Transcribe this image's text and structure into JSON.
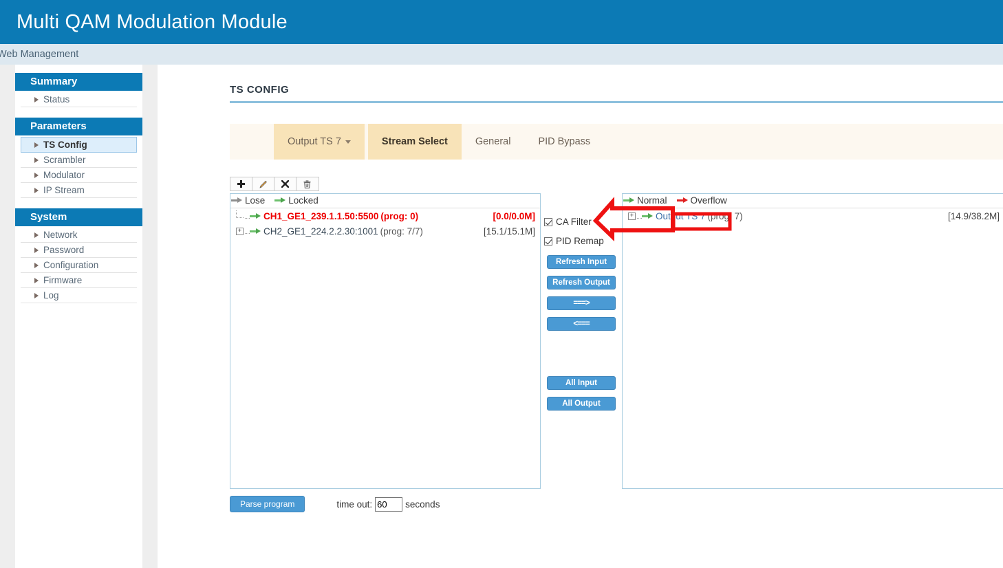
{
  "header": {
    "app_title": "Multi QAM Modulation Module",
    "subheader": "Web Management",
    "brand_color": "#0c7ab5"
  },
  "sidebar": {
    "sections": [
      {
        "title": "Summary",
        "items": [
          {
            "label": "Status",
            "active": false
          }
        ]
      },
      {
        "title": "Parameters",
        "items": [
          {
            "label": "TS Config",
            "active": true
          },
          {
            "label": "Scrambler",
            "active": false
          },
          {
            "label": "Modulator",
            "active": false
          },
          {
            "label": "IP Stream",
            "active": false
          }
        ]
      },
      {
        "title": "System",
        "items": [
          {
            "label": "Network",
            "active": false
          },
          {
            "label": "Password",
            "active": false
          },
          {
            "label": "Configuration",
            "active": false
          },
          {
            "label": "Firmware",
            "active": false
          },
          {
            "label": "Log",
            "active": false
          }
        ]
      }
    ]
  },
  "main": {
    "page_title": "TS CONFIG",
    "tabs": [
      {
        "label": "Output TS 7",
        "type": "dropdown",
        "active": false,
        "tinted": true
      },
      {
        "label": "Stream Select",
        "type": "tab",
        "active": true,
        "tinted": true
      },
      {
        "label": "General",
        "type": "tab",
        "active": false,
        "tinted": false
      },
      {
        "label": "PID Bypass",
        "type": "tab",
        "active": false,
        "tinted": false
      }
    ],
    "toolbar": {
      "add_label": "+",
      "edit_label": "✎",
      "close_label": "✖",
      "delete_label": "Ὕ1"
    },
    "input_panel": {
      "legend": [
        {
          "label": "Lose",
          "arrow": "gray"
        },
        {
          "label": "Locked",
          "arrow": "green"
        }
      ],
      "rows": [
        {
          "name": "CH1_GE1_239.1.1.50:5500",
          "prog": "(prog: 0)",
          "rate": "[0.0/0.0M]",
          "state": "alarm",
          "arrow": "green",
          "expandable": false
        },
        {
          "name": "CH2_GE1_224.2.2.30:1001",
          "prog": "(prog: 7/7)",
          "rate": "[15.1/15.1M]",
          "state": "normal",
          "arrow": "green",
          "expandable": true,
          "expander": "+"
        }
      ]
    },
    "controls": {
      "checkboxes": [
        {
          "label": "CA Filter",
          "checked": true
        },
        {
          "label": "PID Remap",
          "checked": true
        }
      ],
      "buttons": [
        {
          "label": "Refresh Input"
        },
        {
          "label": "Refresh Output"
        },
        {
          "label": "===>"
        },
        {
          "label": "<==="
        }
      ],
      "buttons_lower": [
        {
          "label": "All Input"
        },
        {
          "label": "All Output"
        }
      ]
    },
    "output_panel": {
      "legend": [
        {
          "label": "Normal",
          "arrow": "green"
        },
        {
          "label": "Overflow",
          "arrow": "red"
        }
      ],
      "rows": [
        {
          "name": "Output TS 7",
          "prog": "(prog: 7)",
          "rate": "[14.9/38.2M]",
          "state": "link",
          "arrow": "green",
          "expandable": true,
          "expander": "+",
          "highlighted": true
        }
      ]
    },
    "footer": {
      "parse_label": "Parse program",
      "timeout_label": "time out:",
      "timeout_value": "60",
      "seconds_label": "seconds"
    }
  },
  "annotation": {
    "color": "#ee1111",
    "shape": "left-pointing-arrow-and-box"
  }
}
